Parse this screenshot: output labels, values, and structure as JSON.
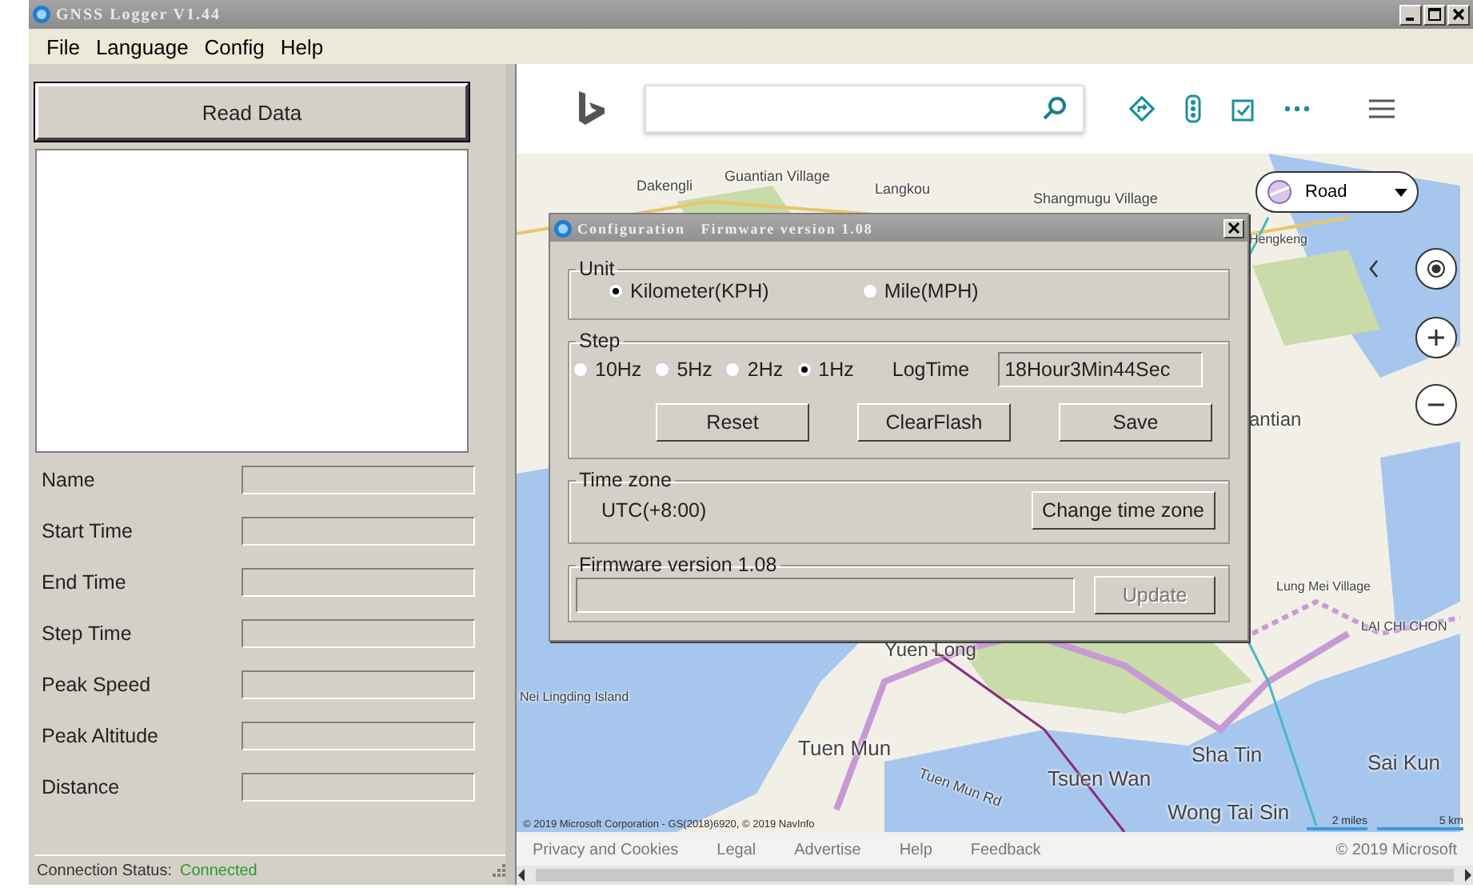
{
  "window": {
    "title": "GNSS Logger V1.44"
  },
  "menu": [
    "File",
    "Language",
    "Config",
    "Help"
  ],
  "left_panel": {
    "read_button": "Read Data",
    "fields": [
      {
        "label": "Name"
      },
      {
        "label": "Start Time"
      },
      {
        "label": "End Time"
      },
      {
        "label": "Step Time"
      },
      {
        "label": "Peak Speed"
      },
      {
        "label": "Peak Altitude"
      },
      {
        "label": "Distance"
      }
    ],
    "status": {
      "label": "Connection Status:",
      "value": "Connected"
    }
  },
  "map": {
    "layer_dropdown": "Road",
    "labels": [
      "Dakengli",
      "Guantian Village",
      "Langkou",
      "Shangmugu Village",
      "Hengkeng",
      "antian",
      "Lung Mei Village",
      "Nei Lingding Island",
      "Yuen Long",
      "Tuen Mun",
      "Tuen Mun Rd",
      "Tsuen Wan",
      "Sha Tin",
      "Sai Kun",
      "Wong Tai Sin",
      "LAI CHI CHON"
    ],
    "copyright_line": "© 2019 Microsoft Corporation - GS(2018)6920, © 2019 NavInfo",
    "scale": [
      "2 miles",
      "5 km"
    ],
    "footer_links": [
      "Privacy and Cookies",
      "Legal",
      "Advertise",
      "Help",
      "Feedback"
    ],
    "footer_copyright": "© 2019 Microsoft"
  },
  "dialog": {
    "title": "Configuration   Firmware version 1.08",
    "unit": {
      "legend": "Unit",
      "options": [
        {
          "label": "Kilometer(KPH)",
          "selected": true
        },
        {
          "label": "Mile(MPH)",
          "selected": false
        }
      ]
    },
    "step": {
      "legend": "Step",
      "options": [
        {
          "label": "10Hz",
          "selected": false
        },
        {
          "label": "5Hz",
          "selected": false
        },
        {
          "label": "2Hz",
          "selected": false
        },
        {
          "label": "1Hz",
          "selected": true
        }
      ],
      "logtime_label": "LogTime",
      "logtime_value": "18Hour3Min44Sec"
    },
    "buttons": [
      "Reset",
      "ClearFlash",
      "Save"
    ],
    "timezone": {
      "legend": "Time zone",
      "value": "UTC(+8:00)",
      "button": "Change time zone"
    },
    "firmware": {
      "legend": "Firmware version 1.08",
      "level": 0,
      "button": {
        "label": "Update",
        "disabled": true
      }
    }
  }
}
